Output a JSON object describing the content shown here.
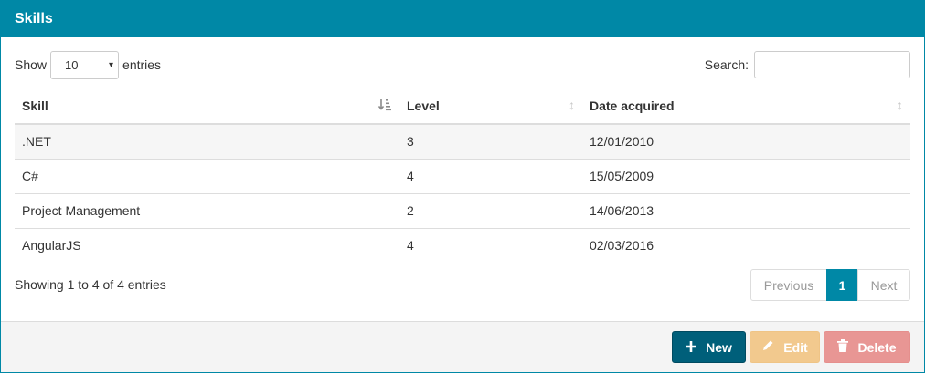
{
  "panel": {
    "title": "Skills"
  },
  "length": {
    "show_label": "Show",
    "selected": "10",
    "entries_label": "entries"
  },
  "search": {
    "label": "Search:",
    "value": ""
  },
  "table": {
    "headers": [
      "Skill",
      "Level",
      "Date acquired"
    ],
    "rows": [
      [
        ".NET",
        "3",
        "12/01/2010"
      ],
      [
        "C#",
        "4",
        "15/05/2009"
      ],
      [
        "Project Management",
        "2",
        "14/06/2013"
      ],
      [
        "AngularJS",
        "4",
        "02/03/2016"
      ]
    ]
  },
  "info": "Showing 1 to 4 of 4 entries",
  "pagination": {
    "previous": "Previous",
    "current": "1",
    "next": "Next"
  },
  "actions": {
    "new": "New",
    "edit": "Edit",
    "delete": "Delete"
  },
  "colors": {
    "primary": "#0088a6",
    "new_btn": "#005f7a",
    "edit_btn": "#f2c98e",
    "delete_btn": "#e89694"
  },
  "icons": {
    "sort_active": "sort-amount-icon",
    "sort": "sort-icon",
    "new": "plus-icon",
    "edit": "pencil-icon",
    "delete": "trash-icon"
  }
}
